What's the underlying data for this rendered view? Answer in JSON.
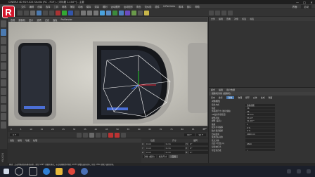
{
  "window": {
    "title": "CINEMA 4D R19.024 Studio (RC - R19) - [未标题 1.c4d *] - 主要",
    "controls": [
      "—",
      "□",
      "✕"
    ]
  },
  "menubar": {
    "items": [
      "文件",
      "编辑",
      "创建",
      "选择",
      "工具",
      "网格",
      "捕捉",
      "动画",
      "模拟",
      "渲染",
      "雕刻",
      "运动跟踪",
      "运动图形",
      "角色",
      "流水线",
      "插件",
      "X-Particles",
      "脚本",
      "窗口",
      "帮助"
    ],
    "right_items": [
      "界面:",
      "启动"
    ]
  },
  "viewport": {
    "menu": [
      "查看",
      "摄像机",
      "显示",
      "选项",
      "过滤",
      "面板",
      "ProRender"
    ],
    "label": "透视视图"
  },
  "object_manager": {
    "menu": [
      "文件",
      "编辑",
      "查看",
      "对象",
      "标签",
      "书签"
    ]
  },
  "attributes": {
    "menu": [
      "模式",
      "编辑",
      "用户数据"
    ],
    "title": "摄像机对象 [摄像机]",
    "tabs": [
      "基本",
      "坐标",
      "对象",
      "物理",
      "细节",
      "立体",
      "合成",
      "球面"
    ],
    "section": "对象属性",
    "rows": [
      {
        "label": "投射方式",
        "value": "透视视图"
      },
      {
        "label": "焦距",
        "value": "36"
      },
      {
        "label": "传感器尺寸 (胶片规格)",
        "value": "36"
      },
      {
        "label": "35毫米等值焦距:",
        "value": "36 mm"
      },
      {
        "label": "视野范围",
        "value": "53.13°"
      },
      {
        "label": "视野 (垂直)",
        "value": "31.417°"
      },
      {
        "label": "缩放",
        "value": "1"
      },
      {
        "label": "胶片水平偏移",
        "value": "0 %"
      },
      {
        "label": "胶片垂直偏移",
        "value": "0 %"
      },
      {
        "label": "目标距离",
        "value": "2000 cm"
      },
      {
        "label": "使用目标对象",
        "value": ""
      },
      {
        "label": "焦点对象",
        "value": ""
      },
      {
        "label": "自定义色温 (K)",
        "value": "6500"
      },
      {
        "label": "仅影响灯光",
        "value": ""
      },
      {
        "label": "导出到合成",
        "value": "✓"
      }
    ]
  },
  "timeline": {
    "ticks": [
      "0",
      "5",
      "10",
      "15",
      "20",
      "25",
      "30",
      "35",
      "40",
      "45",
      "50",
      "55",
      "60",
      "65",
      "70",
      "75",
      "80",
      "85",
      "90"
    ],
    "end_frame": "0 F",
    "start_field": "0 F",
    "end_field1": "90 F",
    "end_field2": "90 F"
  },
  "materials": {
    "menu": [
      "创建",
      "编辑",
      "功能",
      "纹理"
    ]
  },
  "coords": {
    "headers": [
      "位置",
      "尺寸",
      "旋转"
    ],
    "rows": [
      {
        "axis": "X",
        "pos": "0 cm",
        "size": "0 cm",
        "rot_axis": "H",
        "rot": "0°"
      },
      {
        "axis": "Y",
        "pos": "0 cm",
        "size": "0 cm",
        "rot_axis": "P",
        "rot": "0°"
      },
      {
        "axis": "Z",
        "pos": "0 cm",
        "size": "0 cm",
        "rot_axis": "B",
        "rot": "0°"
      }
    ],
    "mode": "对象 (相对)",
    "size_mode": "绝对尺寸",
    "apply": "应用"
  },
  "status": {
    "text": "移动：点击并拖动鼠标移动元素。按住 SHIFT 键量化移动；节点编辑模式时按住 SHIFT 键增加选择对象；按住 CTRL 键减少选择对象。"
  },
  "side_logo": "MAXON",
  "colors": {
    "brand_red": "#d4152a",
    "ui_bg": "#2b2b2b",
    "panel": "#333333",
    "taskbar": "#1b1f2a"
  }
}
